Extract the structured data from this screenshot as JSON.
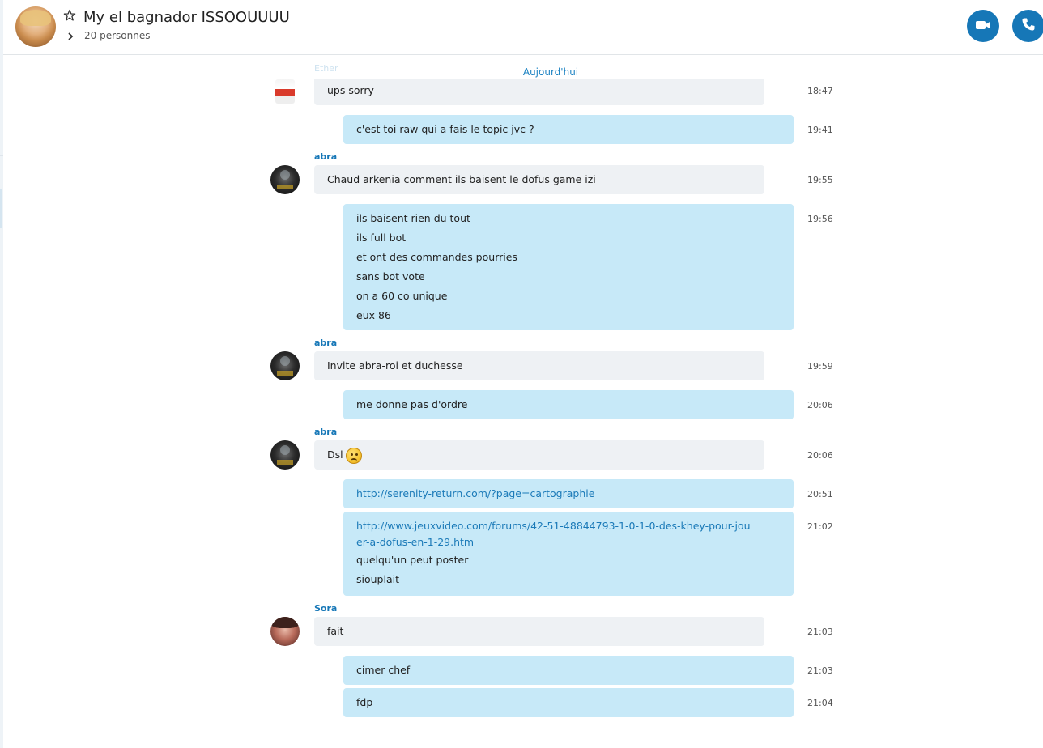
{
  "header": {
    "title": "My el bagnador ISSOOUUUU",
    "subtitle": "20 personnes"
  },
  "icons": {
    "star": "star-outline-icon",
    "chevron": "chevron-right-icon",
    "video": "video-camera-icon",
    "call": "phone-icon"
  },
  "colors": {
    "accent": "#1677b7",
    "outgoing_bubble": "#c7e9f8",
    "incoming_bubble": "#eef1f4"
  },
  "chat": {
    "date_separator": "Aujourd'hui",
    "faded_sender": "Ether",
    "messages": [
      {
        "lines": [
          "ups sorry"
        ],
        "time": "18:47"
      },
      {
        "lines": [
          "c'est toi raw qui a fais le topic jvc ?"
        ],
        "time": "19:41"
      },
      {
        "sender": "abra",
        "lines": [
          "Chaud arkenia comment ils baisent le dofus game izi"
        ],
        "time": "19:55"
      },
      {
        "lines": [
          "ils baisent rien du tout",
          "ils full bot",
          "et ont des commandes pourries",
          "sans bot vote",
          "on a 60 co unique",
          "eux 86"
        ],
        "time": "19:56"
      },
      {
        "sender": "abra",
        "lines": [
          "Invite abra-roi et duchesse"
        ],
        "time": "19:59"
      },
      {
        "lines": [
          "me donne pas d'ordre"
        ],
        "time": "20:06"
      },
      {
        "sender": "abra",
        "lines": [
          "Dsl"
        ],
        "emoji": "sad-face-emoji",
        "time": "20:06"
      },
      {
        "lines": [
          "http://serenity-return.com/?page=cartographie"
        ],
        "time": "20:51"
      },
      {
        "link": "http://www.jeuxvideo.com/forums/42-51-48844793-1-0-1-0-des-khey-pour-jouer-a-dofus-en-1-29.htm",
        "lines": [
          "quelqu'un peut poster",
          "siouplait"
        ],
        "time": "21:02"
      },
      {
        "sender": "Sora",
        "lines": [
          "fait"
        ],
        "time": "21:03"
      },
      {
        "lines": [
          "cimer chef"
        ],
        "time": "21:03"
      },
      {
        "lines": [
          "fdp"
        ],
        "time": "21:04"
      }
    ]
  }
}
